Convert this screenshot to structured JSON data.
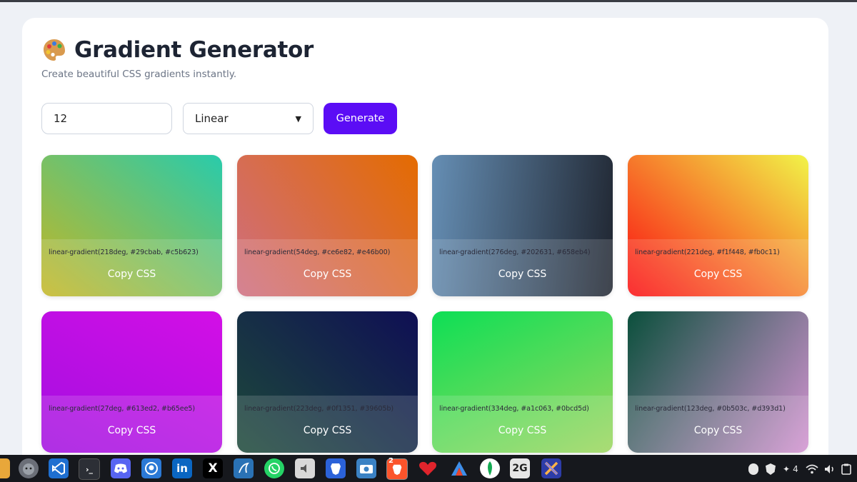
{
  "header": {
    "title": "Gradient Generator",
    "subtitle": "Create beautiful CSS gradients instantly."
  },
  "controls": {
    "count_value": "12",
    "type_selected": "Linear",
    "generate_label": "Generate"
  },
  "cards": [
    {
      "css": "linear-gradient(218deg, #29cbab, #c5b623)",
      "angle": 218,
      "from": "#29cbab",
      "to": "#c5b623",
      "copy_label": "Copy CSS"
    },
    {
      "css": "linear-gradient(54deg, #ce6e82, #e46b00)",
      "angle": 54,
      "from": "#ce6e82",
      "to": "#e46b00",
      "copy_label": "Copy CSS"
    },
    {
      "css": "linear-gradient(276deg, #202631, #658eb4)",
      "angle": 276,
      "from": "#202631",
      "to": "#658eb4",
      "copy_label": "Copy CSS"
    },
    {
      "css": "linear-gradient(221deg, #f1f448, #fb0c11)",
      "angle": 221,
      "from": "#f1f448",
      "to": "#fb0c11",
      "copy_label": "Copy CSS"
    },
    {
      "css": "linear-gradient(27deg, #613ed2, #b65ee5)",
      "angle": 27,
      "from": "#a20fe0",
      "to": "#d30fe6",
      "copy_label": "Copy CSS"
    },
    {
      "css": "linear-gradient(223deg, #0f1351, #39605b)",
      "angle": 223,
      "from": "#0f0f54",
      "to": "#1d4a3a",
      "copy_label": "Copy CSS"
    },
    {
      "css": "linear-gradient(334deg, #a1c063, #0bcd5d)",
      "angle": 334,
      "from": "#9ed65f",
      "to": "#0ddf55",
      "copy_label": "Copy CSS"
    },
    {
      "css": "linear-gradient(123deg, #0b503c, #d393d1)",
      "angle": 123,
      "from": "#0b503c",
      "to": "#d393d1",
      "copy_label": "Copy CSS"
    }
  ],
  "taskbar": {
    "badge_count": "2",
    "tray_number": "4"
  }
}
